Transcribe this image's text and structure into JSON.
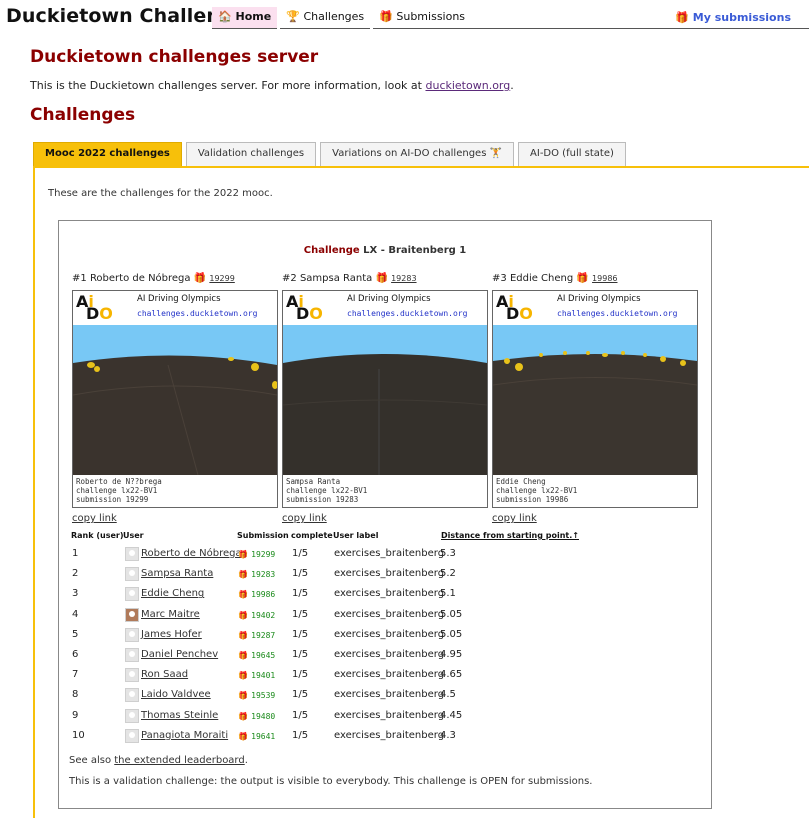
{
  "nav": {
    "brand": "Duckietown Challenges",
    "links": [
      {
        "icon": "home-icon",
        "glyph": "🏠",
        "label": "Home",
        "active": true
      },
      {
        "icon": "trophy-icon",
        "glyph": "🏆",
        "label": "Challenges",
        "active": false
      },
      {
        "icon": "gift-icon",
        "glyph": "🎁",
        "label": "Submissions",
        "active": false
      }
    ],
    "my_submissions": "My submissions",
    "my_submissions_icon": "gift-icon",
    "accent": "#3a5bd6"
  },
  "header": {
    "title": "Duckietown challenges server",
    "intro_prefix": "This is the Duckietown challenges server. For more information, look at ",
    "intro_link": "duckietown.org",
    "intro_suffix": "."
  },
  "challenges_heading": "Challenges",
  "tabs": [
    {
      "label": "Mooc 2022 challenges",
      "active": true
    },
    {
      "label": "Validation challenges",
      "active": false
    },
    {
      "label": "Variations on AI-DO challenges 🏋",
      "active": false
    },
    {
      "label": "AI-DO (full state)",
      "active": false
    }
  ],
  "tab_desc": "These are the challenges for the 2022 mooc.",
  "card": {
    "title_prefix": "Challenge",
    "title_rest": " LX - Braitenberg 1",
    "banner_title": "AI Driving Olympics",
    "banner_url": "challenges.duckietown.org",
    "copy_link": "copy link",
    "top3": [
      {
        "rank": "#1",
        "name": "Roberto de Nóbrega",
        "submission": "19299",
        "caption": [
          "Roberto de N??brega",
          "challenge lx22-BV1",
          "submission 19299"
        ]
      },
      {
        "rank": "#2",
        "name": "Sampsa Ranta",
        "submission": "19283",
        "caption": [
          "Sampsa Ranta",
          "challenge lx22-BV1",
          "submission 19283"
        ]
      },
      {
        "rank": "#3",
        "name": "Eddie Cheng",
        "submission": "19986",
        "caption": [
          "Eddie Cheng",
          "challenge lx22-BV1",
          "submission 19986"
        ]
      }
    ],
    "columns": [
      "Rank (user)",
      "User",
      "Submission",
      "complete",
      "User label",
      "Distance from starting point.↑"
    ],
    "rows": [
      {
        "rank": "1",
        "user": "Roberto de Nóbrega",
        "submission": "19299",
        "complete": "1/5",
        "label": "exercises_braitenberg",
        "distance": "5.3"
      },
      {
        "rank": "2",
        "user": "Sampsa Ranta",
        "submission": "19283",
        "complete": "1/5",
        "label": "exercises_braitenberg",
        "distance": "5.2"
      },
      {
        "rank": "3",
        "user": "Eddie Cheng",
        "submission": "19986",
        "complete": "1/5",
        "label": "exercises_braitenberg",
        "distance": "5.1"
      },
      {
        "rank": "4",
        "user": "Marc Maitre",
        "submission": "19402",
        "complete": "1/5",
        "label": "exercises_braitenberg",
        "distance": "5.05",
        "photo": true
      },
      {
        "rank": "5",
        "user": "James Hofer",
        "submission": "19287",
        "complete": "1/5",
        "label": "exercises_braitenberg",
        "distance": "5.05"
      },
      {
        "rank": "6",
        "user": "Daniel Penchev",
        "submission": "19645",
        "complete": "1/5",
        "label": "exercises_braitenberg",
        "distance": "4.95"
      },
      {
        "rank": "7",
        "user": "Ron Saad",
        "submission": "19401",
        "complete": "1/5",
        "label": "exercises_braitenberg",
        "distance": "4.65"
      },
      {
        "rank": "8",
        "user": "Laido Valdvee",
        "submission": "19539",
        "complete": "1/5",
        "label": "exercises_braitenberg",
        "distance": "4.5"
      },
      {
        "rank": "9",
        "user": "Thomas Steinle",
        "submission": "19480",
        "complete": "1/5",
        "label": "exercises_braitenberg",
        "distance": "4.45"
      },
      {
        "rank": "10",
        "user": "Panagiota Moraiti",
        "submission": "19641",
        "complete": "1/5",
        "label": "exercises_braitenberg",
        "distance": "4.3"
      }
    ],
    "see_also_prefix": "See also ",
    "see_also_link": "the extended leaderboard",
    "see_also_suffix": ".",
    "note": "This is a validation challenge: the output is visible to everybody. This challenge is OPEN for submissions."
  },
  "colors": {
    "heading": "#8b0000",
    "tab_active": "#f7c00a",
    "submission_green": "#1a8a1a",
    "sky": "#78c8f5"
  }
}
